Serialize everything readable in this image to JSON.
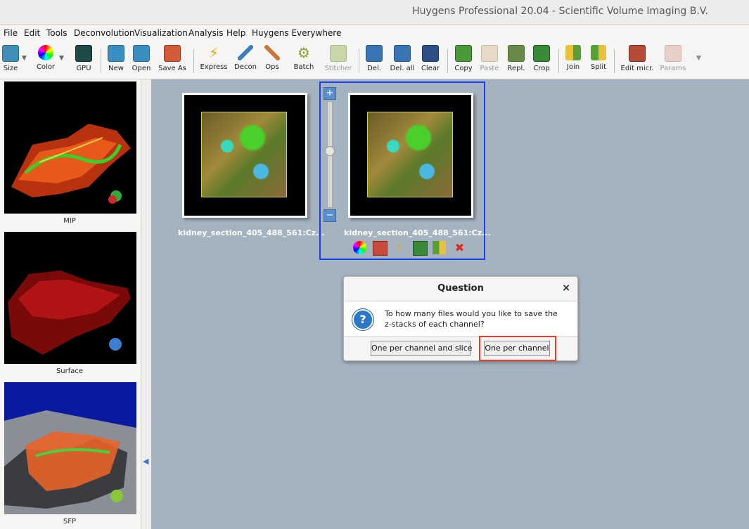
{
  "window": {
    "title": "Huygens Professional 20.04 - Scientific Volume Imaging B.V."
  },
  "menu": [
    "File",
    "Edit",
    "Tools",
    "Deconvolution",
    "Visualization",
    "Analysis",
    "Help",
    "Huygens Everywhere"
  ],
  "toolbar": [
    {
      "label": "Size",
      "icon": "size-icon"
    },
    {
      "label": "Color",
      "icon": "color-wheel-icon"
    },
    {
      "label": "GPU",
      "icon": "gpu-icon"
    },
    {
      "label": "New",
      "icon": "new-icon"
    },
    {
      "label": "Open",
      "icon": "open-icon"
    },
    {
      "label": "Save As",
      "icon": "save-as-icon"
    },
    {
      "label": "Express",
      "icon": "lightning-icon"
    },
    {
      "label": "Decon",
      "icon": "wand-icon"
    },
    {
      "label": "Ops",
      "icon": "wrench-icon"
    },
    {
      "label": "Batch",
      "icon": "gears-icon"
    },
    {
      "label": "Stitcher",
      "icon": "stitcher-icon"
    },
    {
      "label": "Del.",
      "icon": "delete-icon"
    },
    {
      "label": "Del. all",
      "icon": "delete-all-icon"
    },
    {
      "label": "Clear",
      "icon": "clear-icon"
    },
    {
      "label": "Copy",
      "icon": "copy-icon"
    },
    {
      "label": "Paste",
      "icon": "paste-icon"
    },
    {
      "label": "Repl.",
      "icon": "replace-icon"
    },
    {
      "label": "Crop",
      "icon": "crop-icon"
    },
    {
      "label": "Join",
      "icon": "join-icon"
    },
    {
      "label": "Split",
      "icon": "split-icon"
    },
    {
      "label": "Edit micr.",
      "icon": "edit-microscope-icon"
    },
    {
      "label": "Params",
      "icon": "params-icon"
    }
  ],
  "sidebar": {
    "previews": [
      "MIP",
      "Surface",
      "SFP"
    ]
  },
  "images": [
    {
      "label": "kidney_section_405_488_561:Cz..."
    },
    {
      "label": "kidney_section_405_488_561:Cz..."
    }
  ],
  "dialog": {
    "title": "Question",
    "message_line1": "To how many files would you like to save  the",
    "message_line2": "z-stacks of each channel?",
    "close": "×",
    "buttons": [
      "One per channel and slice",
      "One per channel"
    ]
  }
}
